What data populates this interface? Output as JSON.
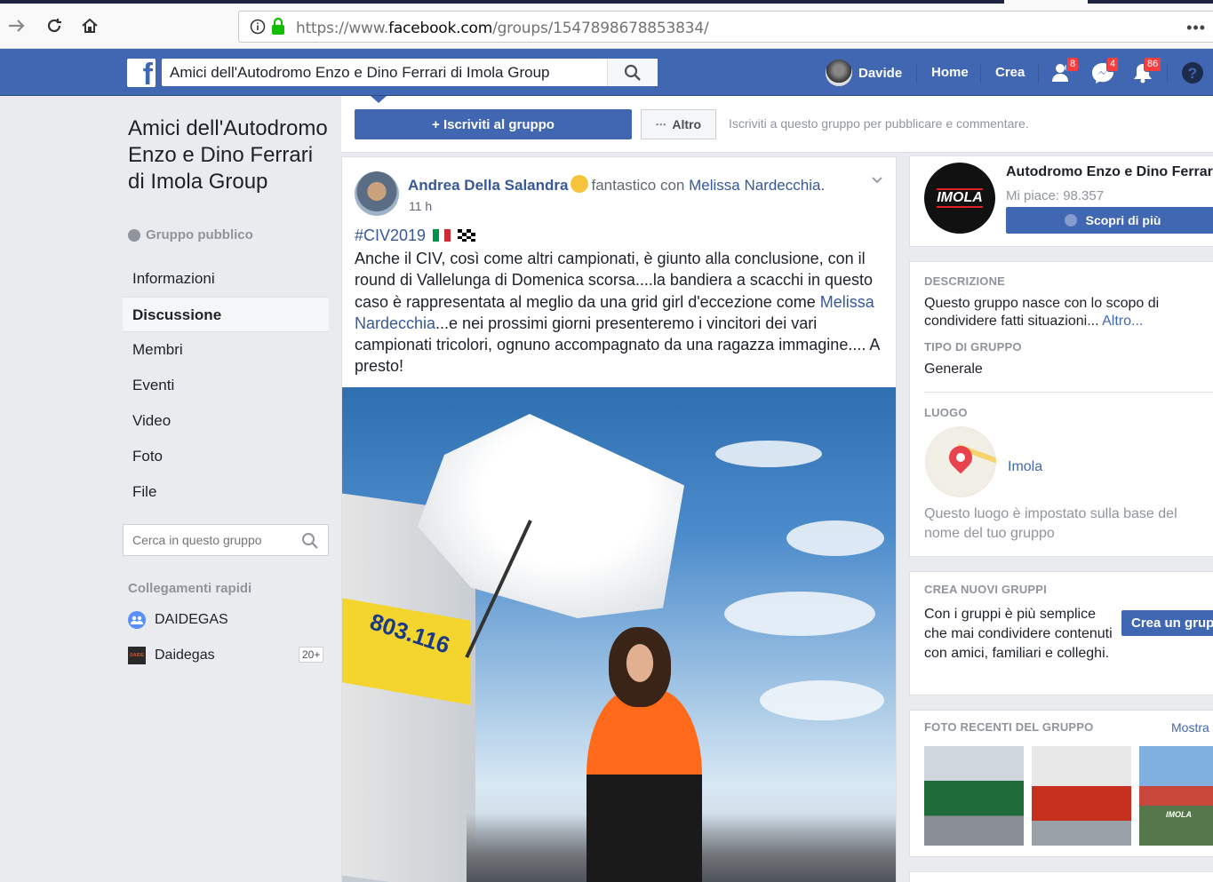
{
  "browser": {
    "url_prefix": "https://www.",
    "url_domain": "facebook.com",
    "url_path": "/groups/1547898678853834/",
    "menu_label": "•••"
  },
  "topbar": {
    "logo_letter": "f",
    "search_value": "Amici dell'Autodromo Enzo e Dino Ferrari di Imola Group",
    "user_name": "Davide",
    "home_label": "Home",
    "create_label": "Crea",
    "friend_requests_count": "8",
    "messages_count": "4",
    "notifications_count": "86",
    "help_label": "?"
  },
  "left": {
    "group_title": "Amici dell'Autodromo Enzo e Dino Ferrari di Imola Group",
    "group_type": "Gruppo pubblico",
    "nav": [
      "Informazioni",
      "Discussione",
      "Membri",
      "Eventi",
      "Video",
      "Foto",
      "File"
    ],
    "active_nav": "Discussione",
    "search_placeholder": "Cerca in questo gruppo",
    "quick_links_title": "Collegamenti rapidi",
    "quick_links": [
      {
        "label": "DAIDEGAS"
      },
      {
        "label": "Daidegas",
        "count": "20+",
        "icon_text": "DAIDE"
      }
    ]
  },
  "join": {
    "join_label": "+ Iscriviti al gruppo",
    "more_label": "Altro",
    "more_dots": "•••",
    "hint": "Iscriviti a questo gruppo per pubblicare e commentare."
  },
  "post": {
    "author": "Andrea Della Salandra",
    "feeling": "fantastico con",
    "tagged": "Melissa Nardecchia",
    "tagged_suffix": ".",
    "time": "11 h",
    "hashtag": "#CIV2019",
    "text_part1": "Anche il CIV, così come altri campionati, è giunto alla conclusione, con il round di Vallelunga di Domenica scorsa....la bandiera a scacchi in questo caso è rappresentata al meglio da una grid girl d'eccezione come ",
    "text_tag": "Melissa Nardecchia",
    "text_part2": "...e nei prossimi giorni presenteremo i vincitori dei vari campionati tricolori, ognuno accompagnato da una ragazza immagine.... A presto!",
    "photo_banner_text": "803.116"
  },
  "right": {
    "page": {
      "logo_text": "IMOLA",
      "name": "Autodromo Enzo e Dino Ferrari",
      "likes": "Mi piace: 98.357",
      "button": "Scopri di più"
    },
    "about": {
      "description_title": "DESCRIZIONE",
      "description_text": "Questo gruppo nasce con lo scopo di condividere fatti situazioni...",
      "description_more": "Altro...",
      "type_title": "TIPO DI GRUPPO",
      "type_value": "Generale",
      "location_title": "LUOGO",
      "location_value": "Imola",
      "location_note": "Questo luogo è impostato sulla base del nome del tuo gruppo"
    },
    "create_groups": {
      "title": "CREA NUOVI GRUPPI",
      "text": "Con i gruppi è più semplice che mai condividere contenuti con amici, familiari e colleghi.",
      "button": "Crea un gruppo"
    },
    "recent_photos": {
      "title": "FOTO RECENTI DEL GRUPPO",
      "more": "Mostra tutto",
      "thumb3_text": "IMOLA"
    }
  },
  "colors": {
    "fb_blue": "#4267b2",
    "link_blue": "#365899",
    "background": "#e9ebee",
    "badge_red": "#fa3e3e"
  }
}
